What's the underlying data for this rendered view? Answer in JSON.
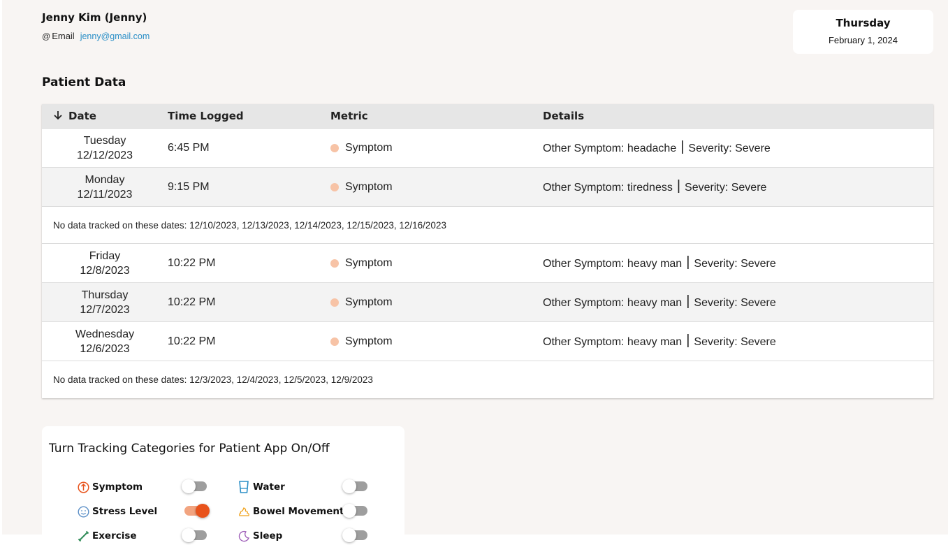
{
  "patient": {
    "name": "Jenny Kim (Jenny)",
    "email_icon": "@",
    "email_label": "Email",
    "email": "jenny@gmail.com"
  },
  "current_date": {
    "weekday": "Thursday",
    "full": "February 1, 2024"
  },
  "section_title": "Patient Data",
  "table": {
    "sort_icon": "arrow-down-icon",
    "columns": {
      "date": "Date",
      "time": "Time Logged",
      "metric": "Metric",
      "details": "Details"
    },
    "groups": [
      {
        "rows": [
          {
            "weekday": "Tuesday",
            "date": "12/12/2023",
            "time": "6:45 PM",
            "metric": "Symptom",
            "detail_a": "Other Symptom: headache",
            "separator": "|",
            "detail_b": "Severity: Severe"
          },
          {
            "weekday": "Monday",
            "date": "12/11/2023",
            "time": "9:15 PM",
            "metric": "Symptom",
            "detail_a": "Other Symptom: tiredness",
            "separator": "|",
            "detail_b": "Severity: Severe"
          }
        ],
        "no_data": "No data tracked on these dates: 12/10/2023, 12/13/2023, 12/14/2023, 12/15/2023, 12/16/2023"
      },
      {
        "rows": [
          {
            "weekday": "Friday",
            "date": "12/8/2023",
            "time": "10:22 PM",
            "metric": "Symptom",
            "detail_a": "Other Symptom: heavy man",
            "separator": "|",
            "detail_b": "Severity: Severe"
          },
          {
            "weekday": "Thursday",
            "date": "12/7/2023",
            "time": "10:22 PM",
            "metric": "Symptom",
            "detail_a": "Other Symptom: heavy man",
            "separator": "|",
            "detail_b": "Severity: Severe"
          },
          {
            "weekday": "Wednesday",
            "date": "12/6/2023",
            "time": "10:22 PM",
            "metric": "Symptom",
            "detail_a": "Other Symptom: heavy man",
            "separator": "|",
            "detail_b": "Severity: Severe"
          }
        ],
        "no_data": "No data tracked on these dates: 12/3/2023, 12/4/2023, 12/5/2023, 12/9/2023"
      }
    ],
    "metric_dot_color": "#f7c3a6"
  },
  "tracking": {
    "title": "Turn Tracking Categories for Patient App On/Off",
    "categories": [
      {
        "label": "Symptom",
        "icon": "symptom-icon",
        "on": false
      },
      {
        "label": "Water",
        "icon": "water-glass-icon",
        "on": false
      },
      {
        "label": "Stress Level",
        "icon": "smiley-icon",
        "on": true
      },
      {
        "label": "Bowel Movement",
        "icon": "bowel-icon",
        "on": false
      },
      {
        "label": "Exercise",
        "icon": "exercise-icon",
        "on": false
      },
      {
        "label": "Sleep",
        "icon": "sleep-icon",
        "on": false
      }
    ],
    "toggle_on_color": "#e8531c"
  }
}
